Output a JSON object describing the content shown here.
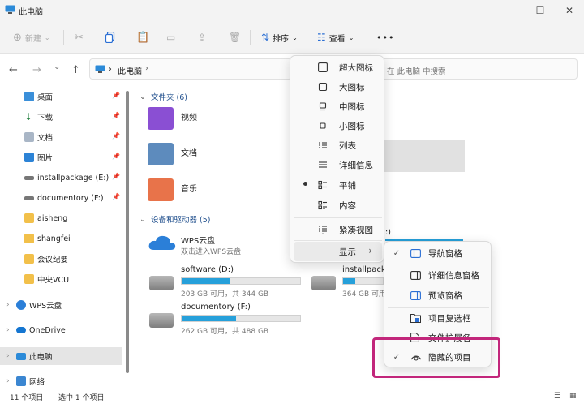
{
  "window": {
    "title": "此电脑",
    "minimize": "—",
    "maximize": "☐",
    "close": "✕"
  },
  "toolbar": {
    "new_label": "新建",
    "sort_label": "排序",
    "view_label": "查看",
    "more_label": "•••"
  },
  "nav": {
    "back": "←",
    "forward": "→",
    "recent": "⌄",
    "up": "↑",
    "breadcrumb": "此电脑",
    "crumb_arrow": "›",
    "search_placeholder": "在 此电脑 中搜索"
  },
  "sidebar": {
    "items": [
      {
        "label": "桌面",
        "pinned": true
      },
      {
        "label": "下载",
        "pinned": true
      },
      {
        "label": "文档",
        "pinned": true
      },
      {
        "label": "图片",
        "pinned": true
      },
      {
        "label": "installpackage (E:)",
        "pinned": true
      },
      {
        "label": "documentory (F:)",
        "pinned": true
      },
      {
        "label": "aisheng"
      },
      {
        "label": "shangfei"
      },
      {
        "label": "会议纪要"
      },
      {
        "label": "中央VCU"
      }
    ],
    "roots": [
      {
        "label": "WPS云盘"
      },
      {
        "label": "OneDrive"
      },
      {
        "label": "此电脑"
      },
      {
        "label": "网络"
      }
    ]
  },
  "main": {
    "folders_header": "文件夹 (6)",
    "folders": [
      "视频",
      "文档",
      "音乐"
    ],
    "devices_header": "设备和驱动器 (5)",
    "wps": {
      "name": "WPS云盘",
      "desc": "双击进入WPS云盘"
    },
    "drives": [
      {
        "name": "software (D:)",
        "free": "203 GB 可用，共 344 GB",
        "used_pct": 41
      },
      {
        "name": "installpacka",
        "free": "364 GB 可用，",
        "used_pct": 30
      },
      {
        "name": "documentory (F:)",
        "free": "262 GB 可用，共 488 GB",
        "used_pct": 46
      }
    ],
    "partial_label": ":)"
  },
  "view_menu": {
    "items": [
      {
        "label": "超大图标"
      },
      {
        "label": "大图标"
      },
      {
        "label": "中图标"
      },
      {
        "label": "小图标"
      },
      {
        "label": "列表"
      },
      {
        "label": "详细信息"
      },
      {
        "label": "平铺",
        "selected": true
      },
      {
        "label": "内容"
      },
      {
        "label": "紧凑视图"
      },
      {
        "label": "显示",
        "submenu_arrow": "›"
      }
    ]
  },
  "show_submenu": {
    "items": [
      {
        "label": "导航窗格",
        "checked": true
      },
      {
        "label": "详细信息窗格"
      },
      {
        "label": "预览窗格"
      },
      {
        "label": "项目复选框"
      },
      {
        "label": "文件扩展名"
      },
      {
        "label": "隐藏的项目",
        "checked": true
      }
    ],
    "check_glyph": "✓"
  },
  "status": {
    "count": "11 个项目",
    "selected": "选中 1 个项目"
  },
  "colors": {
    "accent": "#26a0da",
    "highlight": "#c2267b",
    "folder_video": "#8a4fd3",
    "folder_doc": "#5d8bbd",
    "folder_music": "#e8734a"
  }
}
